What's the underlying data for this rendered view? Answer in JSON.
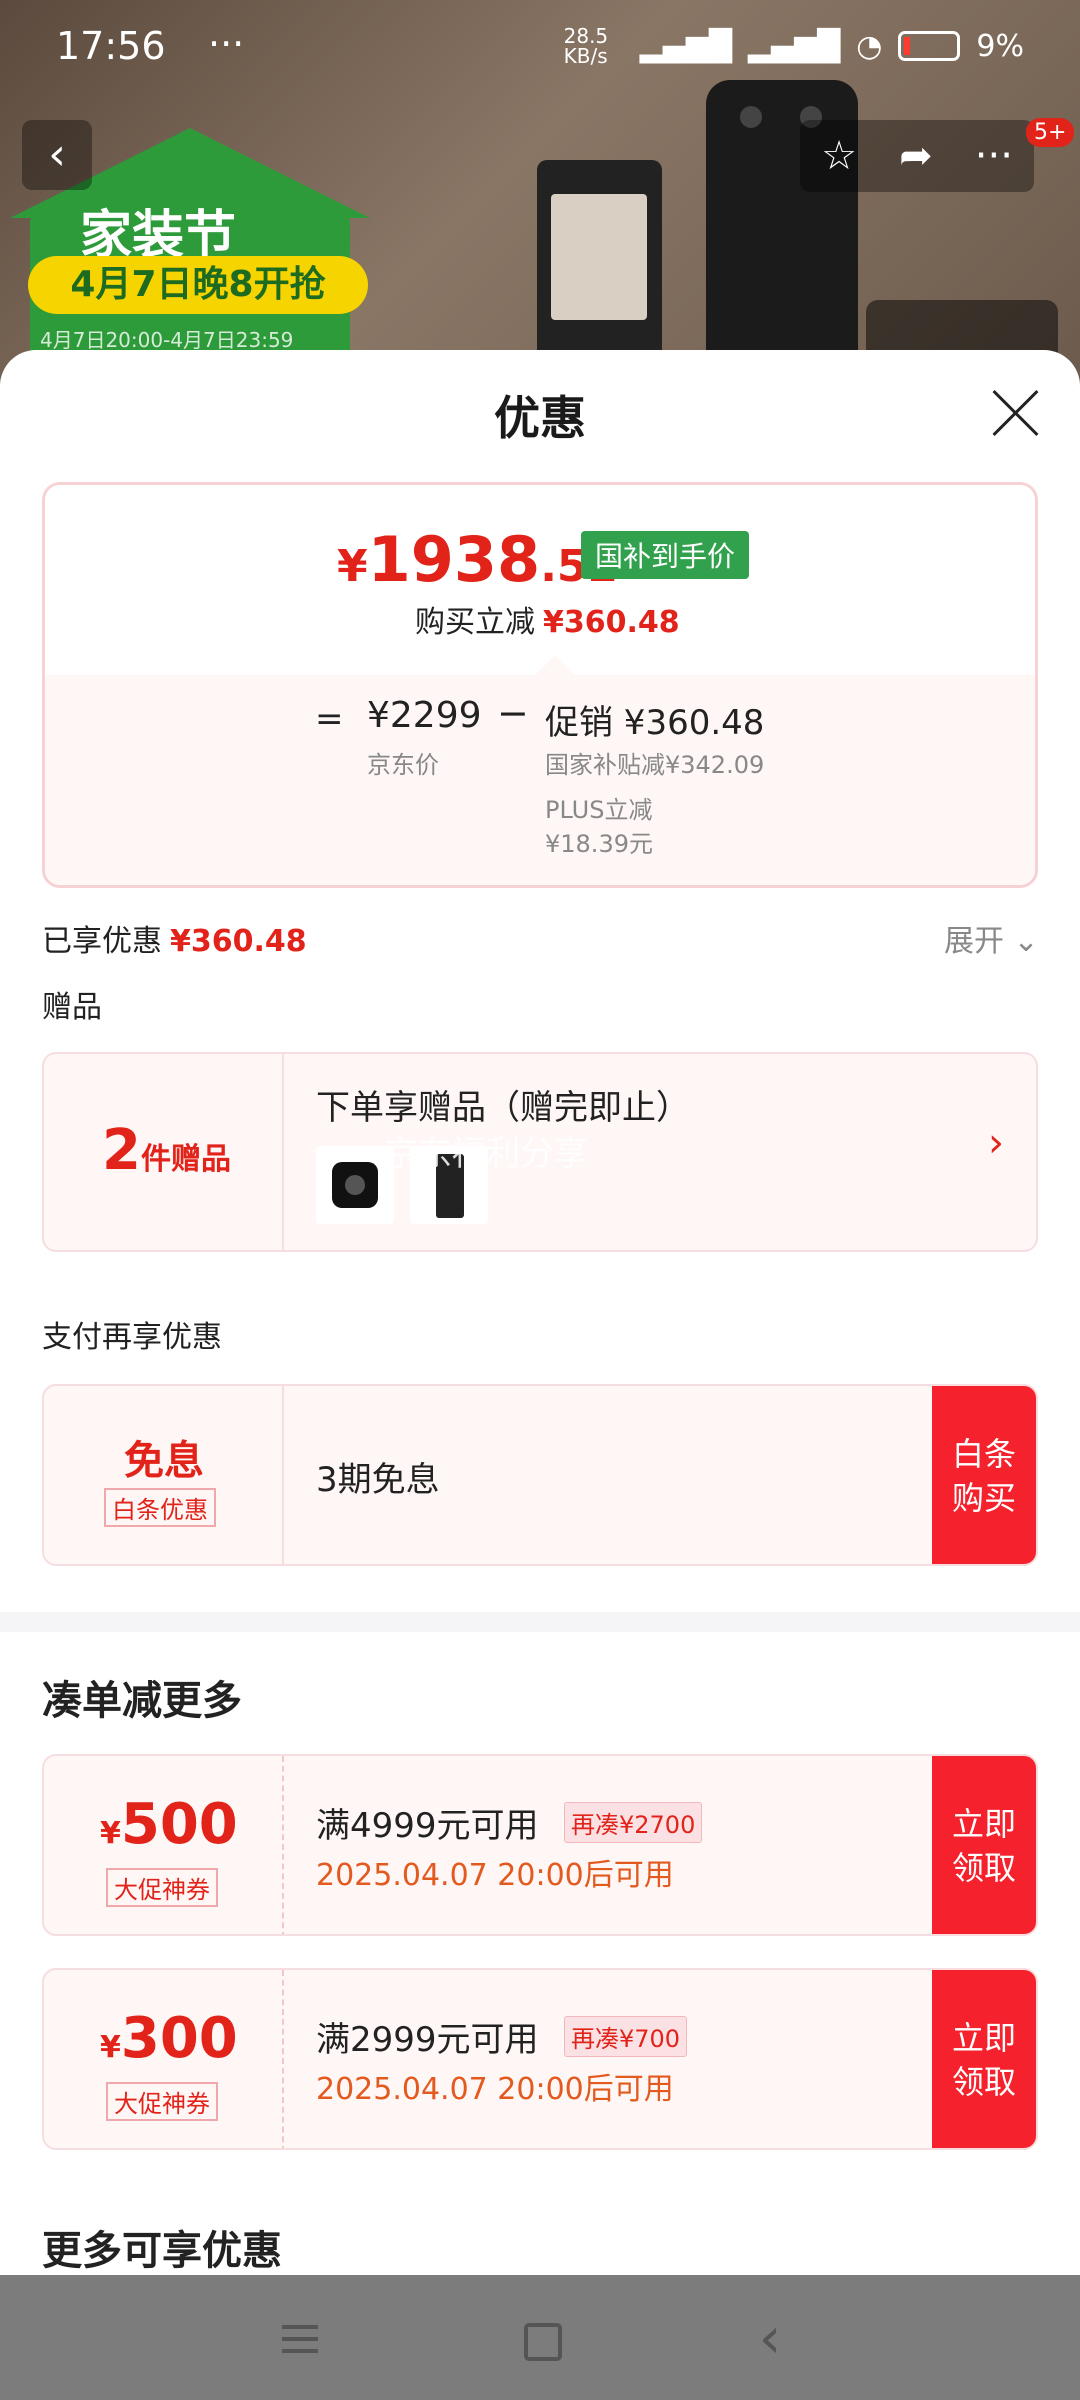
{
  "status_bar": {
    "time": "17:56",
    "dots": "···",
    "net_speed": "28.5 KB/s",
    "battery": "9%"
  },
  "background": {
    "promo_title": "家装节",
    "promo_date": "4月7日晚8开抢",
    "promo_range": "4月7日20:00-4月7日23:59",
    "nav_more": "···",
    "badge": "5+"
  },
  "sheet": {
    "title": "优惠",
    "price": {
      "symbol": "¥",
      "integer": "1938",
      "decimal": ".52",
      "tag": "国补到手价",
      "sub_label": "购买立减",
      "sub_value": "¥360.48"
    },
    "breakdown": {
      "equals": "=",
      "jd_price": "¥2299",
      "jd_label": "京东价",
      "minus": "−",
      "promo_total": "促销 ¥360.48",
      "gov_subsidy": "国家补贴减¥342.09",
      "plus_label": "PLUS立减",
      "plus_value": "¥18.39元"
    },
    "enjoyed_label": "已享优惠",
    "enjoyed_value": "¥360.48",
    "expand_label": "展开 ⌄",
    "gift_section": "赠品",
    "gift": {
      "count": "2",
      "count_unit": "件赠品",
      "title": "下单享赠品（赠完即止）",
      "watermark": "京东福利分享",
      "arrow": "›"
    },
    "pay_section": "支付再享优惠",
    "pay": {
      "main": "免息",
      "tag": "白条优惠",
      "desc": "3期免息",
      "button": "白条购买"
    },
    "more_title": "凑单减更多",
    "coupons": [
      {
        "symbol": "¥",
        "amount": "500",
        "tag": "大促神券",
        "condition": "满4999元可用",
        "diff": "再凑¥2700",
        "time": "2025.04.07 20:00后可用",
        "button": "立即领取"
      },
      {
        "symbol": "¥",
        "amount": "300",
        "tag": "大促神券",
        "condition": "满2999元可用",
        "diff": "再凑¥700",
        "time": "2025.04.07 20:00后可用",
        "button": "立即领取"
      }
    ],
    "more_enjoy": "更多可享优惠"
  },
  "nav_bar": {
    "back": "‹"
  },
  "colors": {
    "accent_red": "#e2231a",
    "button_red": "#f5222d",
    "green_tag": "#31a14d",
    "card_bg": "#fff6f6"
  }
}
